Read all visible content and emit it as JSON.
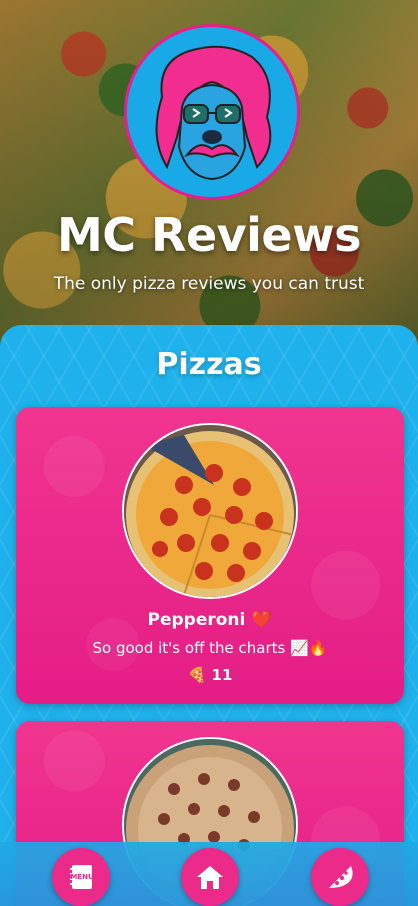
{
  "header": {
    "title": "MC Reviews",
    "subtitle": "The only pizza reviews you can trust"
  },
  "section": {
    "title": "Pizzas"
  },
  "pizzas": [
    {
      "name": "Pepperoni",
      "name_emoji": "❤️",
      "description": "So good it's off the charts 📈🔥",
      "slice_icon": "🍕",
      "count": "11"
    },
    {
      "name": "",
      "description": "",
      "count": ""
    }
  ],
  "nav": {
    "menu_label": "MENU",
    "items": [
      {
        "icon": "menu-book-icon"
      },
      {
        "icon": "home-icon"
      },
      {
        "icon": "pizza-slice-icon"
      }
    ]
  },
  "colors": {
    "accent": "#ec2a8a",
    "section_bg": "#1fb1ec",
    "text": "#ffffff"
  }
}
